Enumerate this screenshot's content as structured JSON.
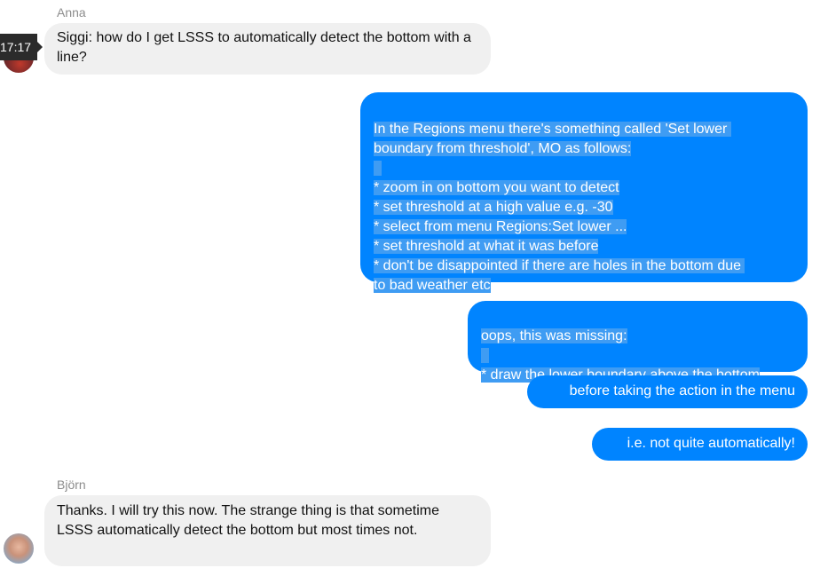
{
  "messages": {
    "anna": {
      "name": "Anna",
      "time": "17:17",
      "text": "Siggi: how do I get LSSS to automatically detect the bottom with a line?"
    },
    "reply1": {
      "l1": "In the Regions menu there's something called 'Set lower ",
      "l2": "boundary from threshold', MO as follows:",
      "l3": "* zoom in on bottom you want to detect",
      "l4": "* set threshold at a high value e.g. -30",
      "l5": "* select from menu Regions:Set lower ...",
      "l6": "* set threshold at what it was before",
      "l7": "* don't be disappointed if there are holes in the bottom due ",
      "l8": "to bad weather etc"
    },
    "reply2": {
      "l1": "oops, this was missing:",
      "l2": "* draw the lower boundary above the bottom"
    },
    "reply3": "before taking the action in the menu",
    "reply4": "i.e. not quite automatically!",
    "bjorn": {
      "name": "Björn",
      "text": "Thanks. I will try this now. The strange thing is that sometime LSSS automatically detect the bottom but most times not."
    }
  },
  "colors": {
    "outgoing": "#0084ff",
    "incoming": "#f0f0f0",
    "selection": "#3f9cf3"
  }
}
